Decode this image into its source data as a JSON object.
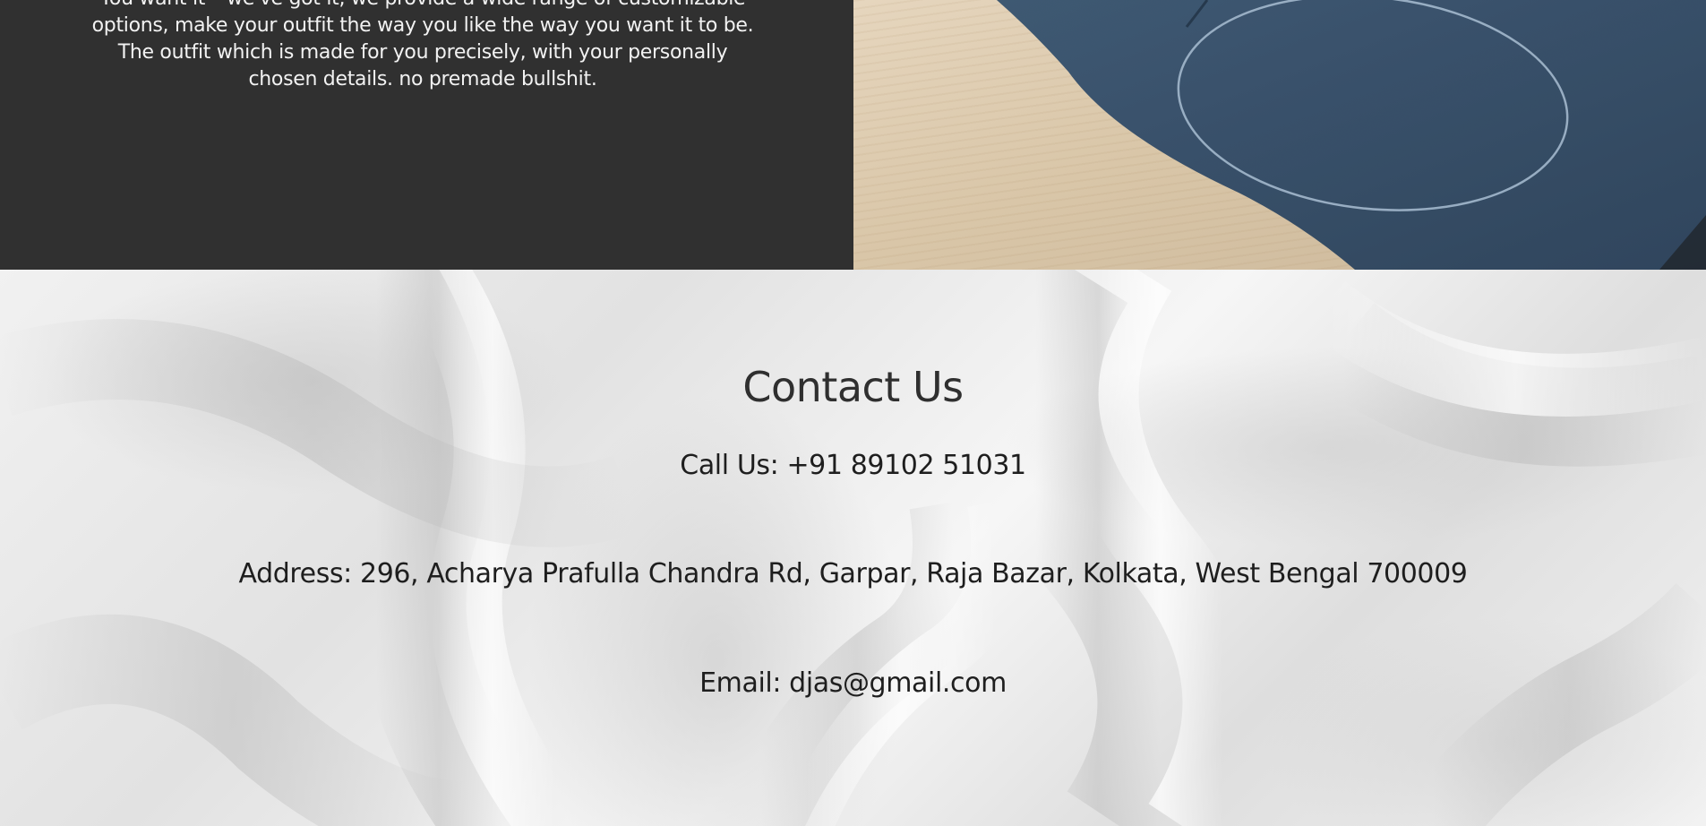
{
  "intro": {
    "text": "You want it – we've got it, we provide a wide range of customizable options, make your outfit the way you like the way you want it to be. The outfit which is made for you precisely, with your personally chosen details. no premade bullshit."
  },
  "contact": {
    "title": "Contact Us",
    "phone": "Call Us: +91 89102 51031",
    "address": "Address: 296, Acharya Prafulla Chandra Rd, Garpar, Raja Bazar, Kolkata, West Bengal 700009",
    "email": "Email: djas@gmail.com"
  },
  "colors": {
    "panel_background": "#303030",
    "panel_text": "#f2f2f2",
    "leather": "#2f4760",
    "contact_heading": "#2f2f2f",
    "contact_text": "#1e1e1e"
  }
}
